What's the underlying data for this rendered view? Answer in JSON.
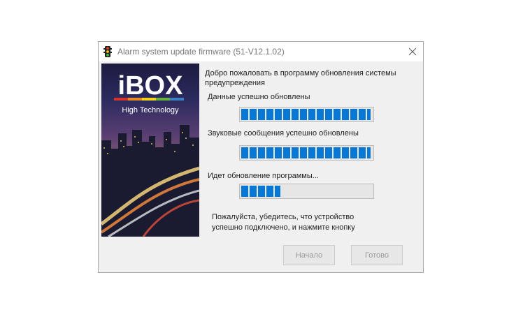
{
  "window": {
    "title": "Alarm system update firmware (51-V12.1.02)"
  },
  "banner": {
    "brand": "iBOX",
    "tagline": "High Technology"
  },
  "intro_text": "Добро пожаловать в программу обновления системы предупреждения",
  "steps": [
    {
      "label": "Данные успешно обновлены",
      "progress": 1.0
    },
    {
      "label": "Звуковые сообщения успешно обновлены",
      "progress": 1.0
    },
    {
      "label": "Идет обновление программы...",
      "progress": 0.3
    }
  ],
  "instruction_line1": "Пожалуйста, убедитесь, что устройство",
  "instruction_line2": "успешно подключено, и нажмите кнопку",
  "buttons": {
    "start_label": "Начало",
    "done_label": "Готово"
  },
  "colors": {
    "progress_fill": "#0678d4",
    "brand_stripes": [
      "#d3332c",
      "#e88b26",
      "#f2d21e",
      "#6ab23e",
      "#3e7fc4"
    ]
  },
  "icons": {
    "app": "traffic-light-icon",
    "close": "close-icon"
  }
}
